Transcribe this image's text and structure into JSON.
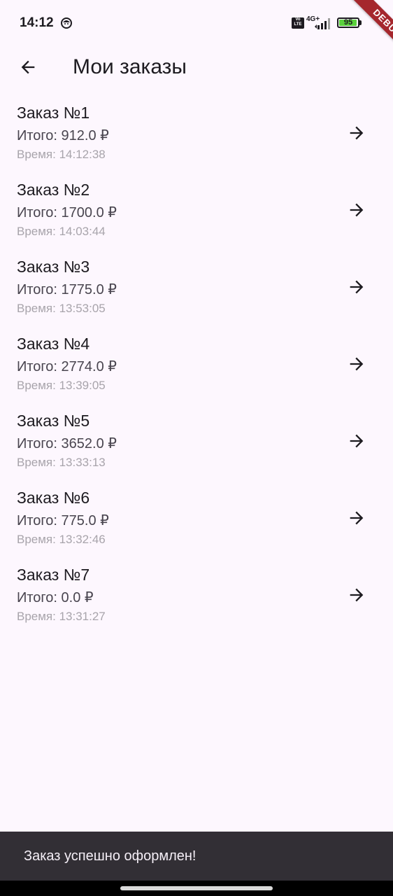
{
  "status_bar": {
    "time": "14:12",
    "volte_label": "Vo LTE",
    "network_label": "4G+",
    "battery_level": "95",
    "battery_color": "#5bd13d"
  },
  "debug_banner": "DEBUG",
  "app_bar": {
    "back_icon": "arrow-back-icon",
    "title": "Мои заказы"
  },
  "orders": [
    {
      "title": "Заказ №1",
      "total": "Итого: 912.0 ₽",
      "time": "Время: 14:12:38"
    },
    {
      "title": "Заказ №2",
      "total": "Итого: 1700.0 ₽",
      "time": "Время: 14:03:44"
    },
    {
      "title": "Заказ №3",
      "total": "Итого: 1775.0 ₽",
      "time": "Время: 13:53:05"
    },
    {
      "title": "Заказ №4",
      "total": "Итого: 2774.0 ₽",
      "time": "Время: 13:39:05"
    },
    {
      "title": "Заказ №5",
      "total": "Итого: 3652.0 ₽",
      "time": "Время: 13:33:13"
    },
    {
      "title": "Заказ №6",
      "total": "Итого: 775.0 ₽",
      "time": "Время: 13:32:46"
    },
    {
      "title": "Заказ №7",
      "total": "Итого: 0.0 ₽",
      "time": "Время: 13:31:27"
    }
  ],
  "snackbar": {
    "message": "Заказ успешно оформлен!"
  },
  "colors": {
    "background": "#fdf7fe",
    "snackbar": "#322f35",
    "debug_ribbon": "#a5272d"
  }
}
